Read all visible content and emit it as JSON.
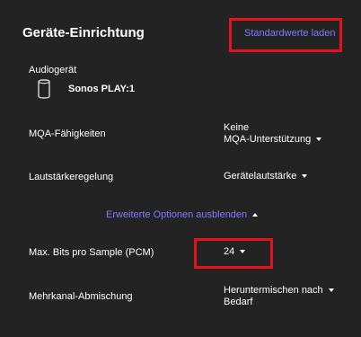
{
  "title": "Geräte-Einrichtung",
  "reset_link": "Standardwerte laden",
  "device": {
    "label": "Audiogerät",
    "name": "Sonos PLAY:1",
    "icon": "speaker-icon"
  },
  "rows": {
    "mqa": {
      "label": "MQA-Fähigkeiten",
      "value_line1": "Keine",
      "value_line2": "MQA-Unterstützung"
    },
    "volume": {
      "label": "Lautstärkeregelung",
      "value": "Gerätelautstärke"
    },
    "bits": {
      "label": "Max. Bits pro Sample (PCM)",
      "value": "24"
    },
    "multichannel": {
      "label": "Mehrkanal-Abmischung",
      "value_line1": "Heruntermischen nach",
      "value_line2": "Bedarf"
    }
  },
  "advanced_toggle": "Erweiterte Optionen ausblenden",
  "colors": {
    "background": "#232323",
    "accent": "#7b7dff",
    "highlight": "#e4121e"
  }
}
